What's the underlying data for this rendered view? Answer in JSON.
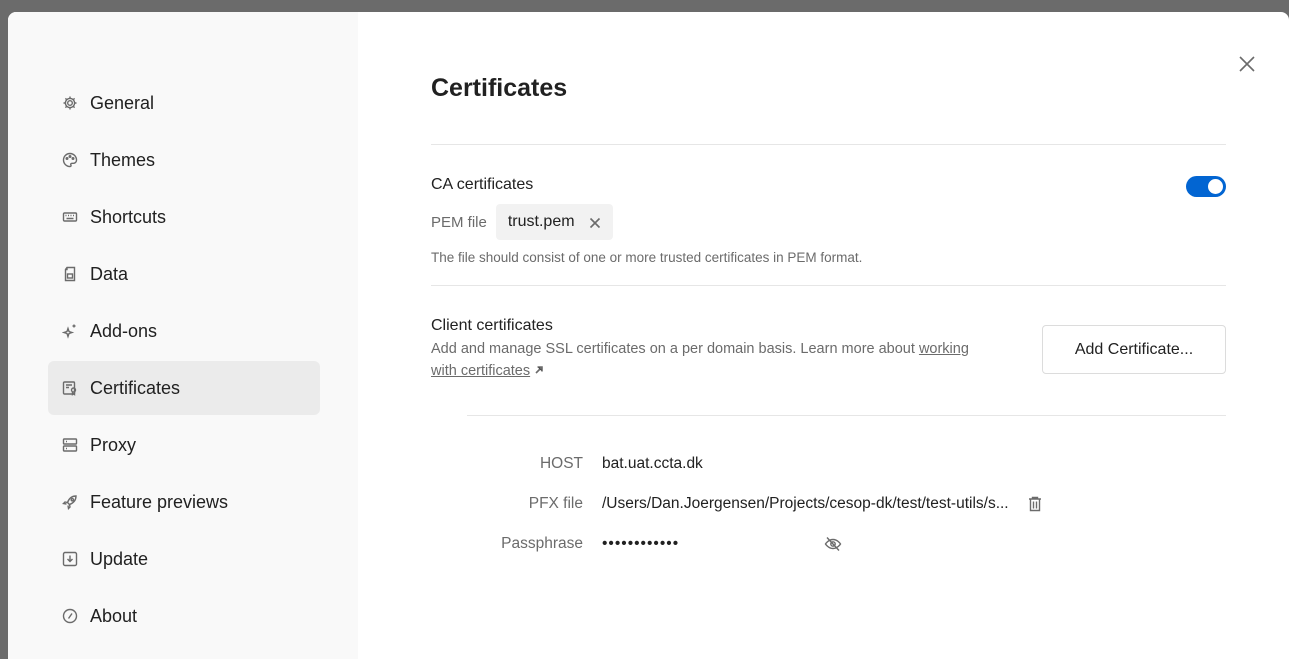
{
  "sidebar": {
    "items": [
      {
        "label": "General",
        "icon": "gear-icon"
      },
      {
        "label": "Themes",
        "icon": "palette-icon"
      },
      {
        "label": "Shortcuts",
        "icon": "keyboard-icon"
      },
      {
        "label": "Data",
        "icon": "document-icon"
      },
      {
        "label": "Add-ons",
        "icon": "sparkle-icon"
      },
      {
        "label": "Certificates",
        "icon": "certificate-icon",
        "active": true
      },
      {
        "label": "Proxy",
        "icon": "server-icon"
      },
      {
        "label": "Feature previews",
        "icon": "rocket-icon"
      },
      {
        "label": "Update",
        "icon": "download-icon"
      },
      {
        "label": "About",
        "icon": "info-icon"
      }
    ]
  },
  "main": {
    "title": "Certificates",
    "ca": {
      "label": "CA certificates",
      "enabled": true,
      "pem_label": "PEM file",
      "pem_file": "trust.pem",
      "help": "The file should consist of one or more trusted certificates in PEM format."
    },
    "client": {
      "label": "Client certificates",
      "desc_prefix": "Add and manage SSL certificates on a per domain basis. Learn more about ",
      "link_text": "working with certificates",
      "add_button": "Add Certificate...",
      "cert": {
        "host_label": "HOST",
        "host": "bat.uat.ccta.dk",
        "pfx_label": "PFX file",
        "pfx": "/Users/Dan.Joergensen/Projects/cesop-dk/test/test-utils/s...",
        "pass_label": "Passphrase",
        "pass": "••••••••••••"
      }
    }
  },
  "colors": {
    "accent": "#0265d2",
    "sidebar_bg": "#f9f9f9",
    "active_bg": "#ebebeb",
    "backdrop": "#6b6b6b"
  }
}
